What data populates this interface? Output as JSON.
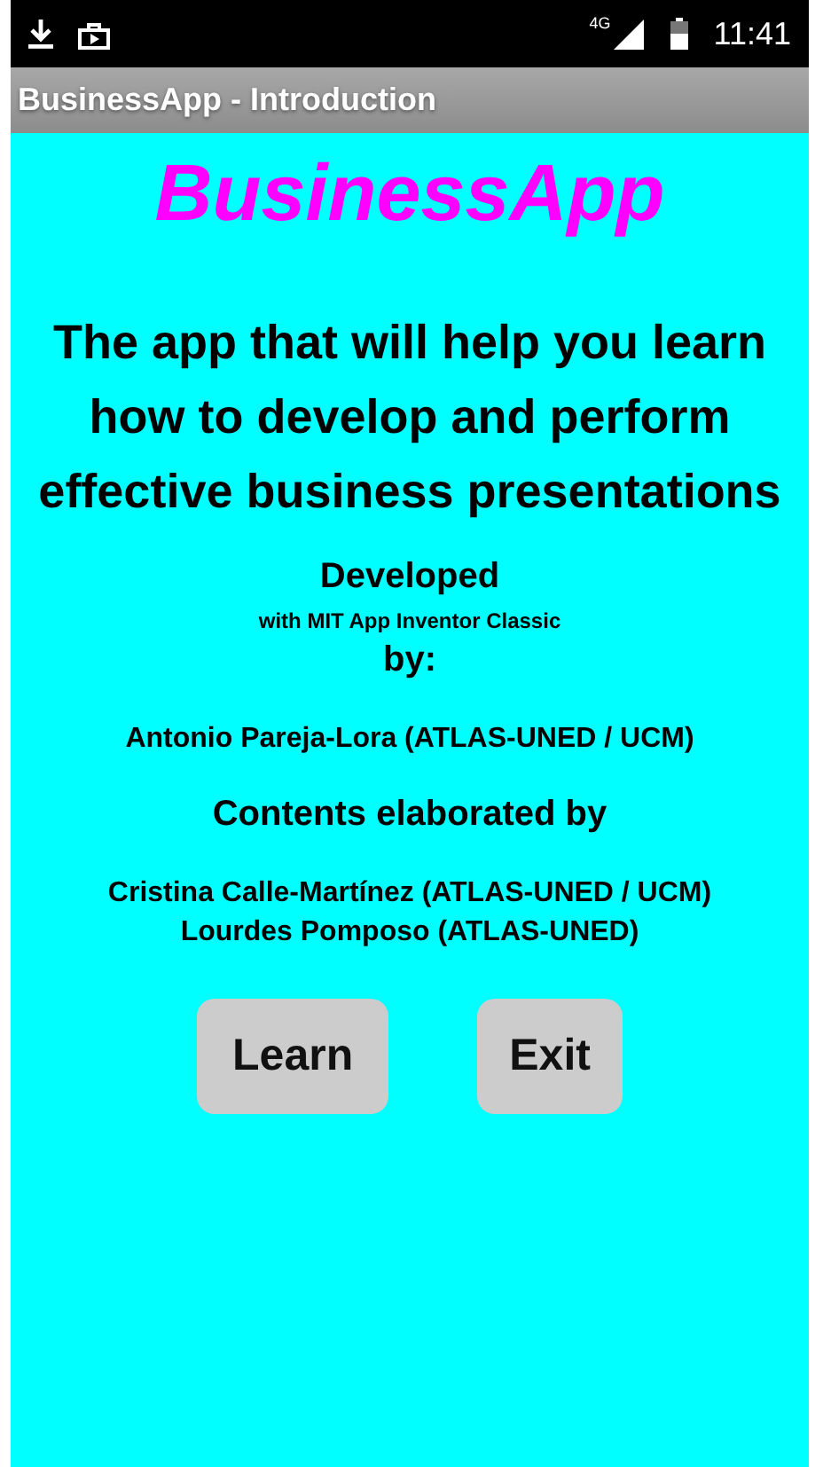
{
  "status_bar": {
    "network": "4G",
    "time": "11:41"
  },
  "title_bar": {
    "title": "BusinessApp - Introduction"
  },
  "app_title": "BusinessApp",
  "tagline": "The app that will help you learn how to develop and perform effective business presentations",
  "credits": [
    {
      "kind": "heading",
      "text": "Developed"
    },
    {
      "kind": "note",
      "text": "with MIT App Inventor Classic"
    },
    {
      "kind": "heading",
      "text": "by:"
    },
    {
      "kind": "name",
      "text": "Antonio Pareja-Lora (ATLAS-UNED / UCM)"
    },
    {
      "kind": "heading",
      "text": "Contents elaborated by"
    },
    {
      "kind": "name",
      "text": "Cristina Calle-Martínez (ATLAS-UNED / UCM)"
    },
    {
      "kind": "name",
      "text": "Lourdes Pomposo (ATLAS-UNED)"
    }
  ],
  "buttons": [
    "Learn",
    "Exit"
  ]
}
